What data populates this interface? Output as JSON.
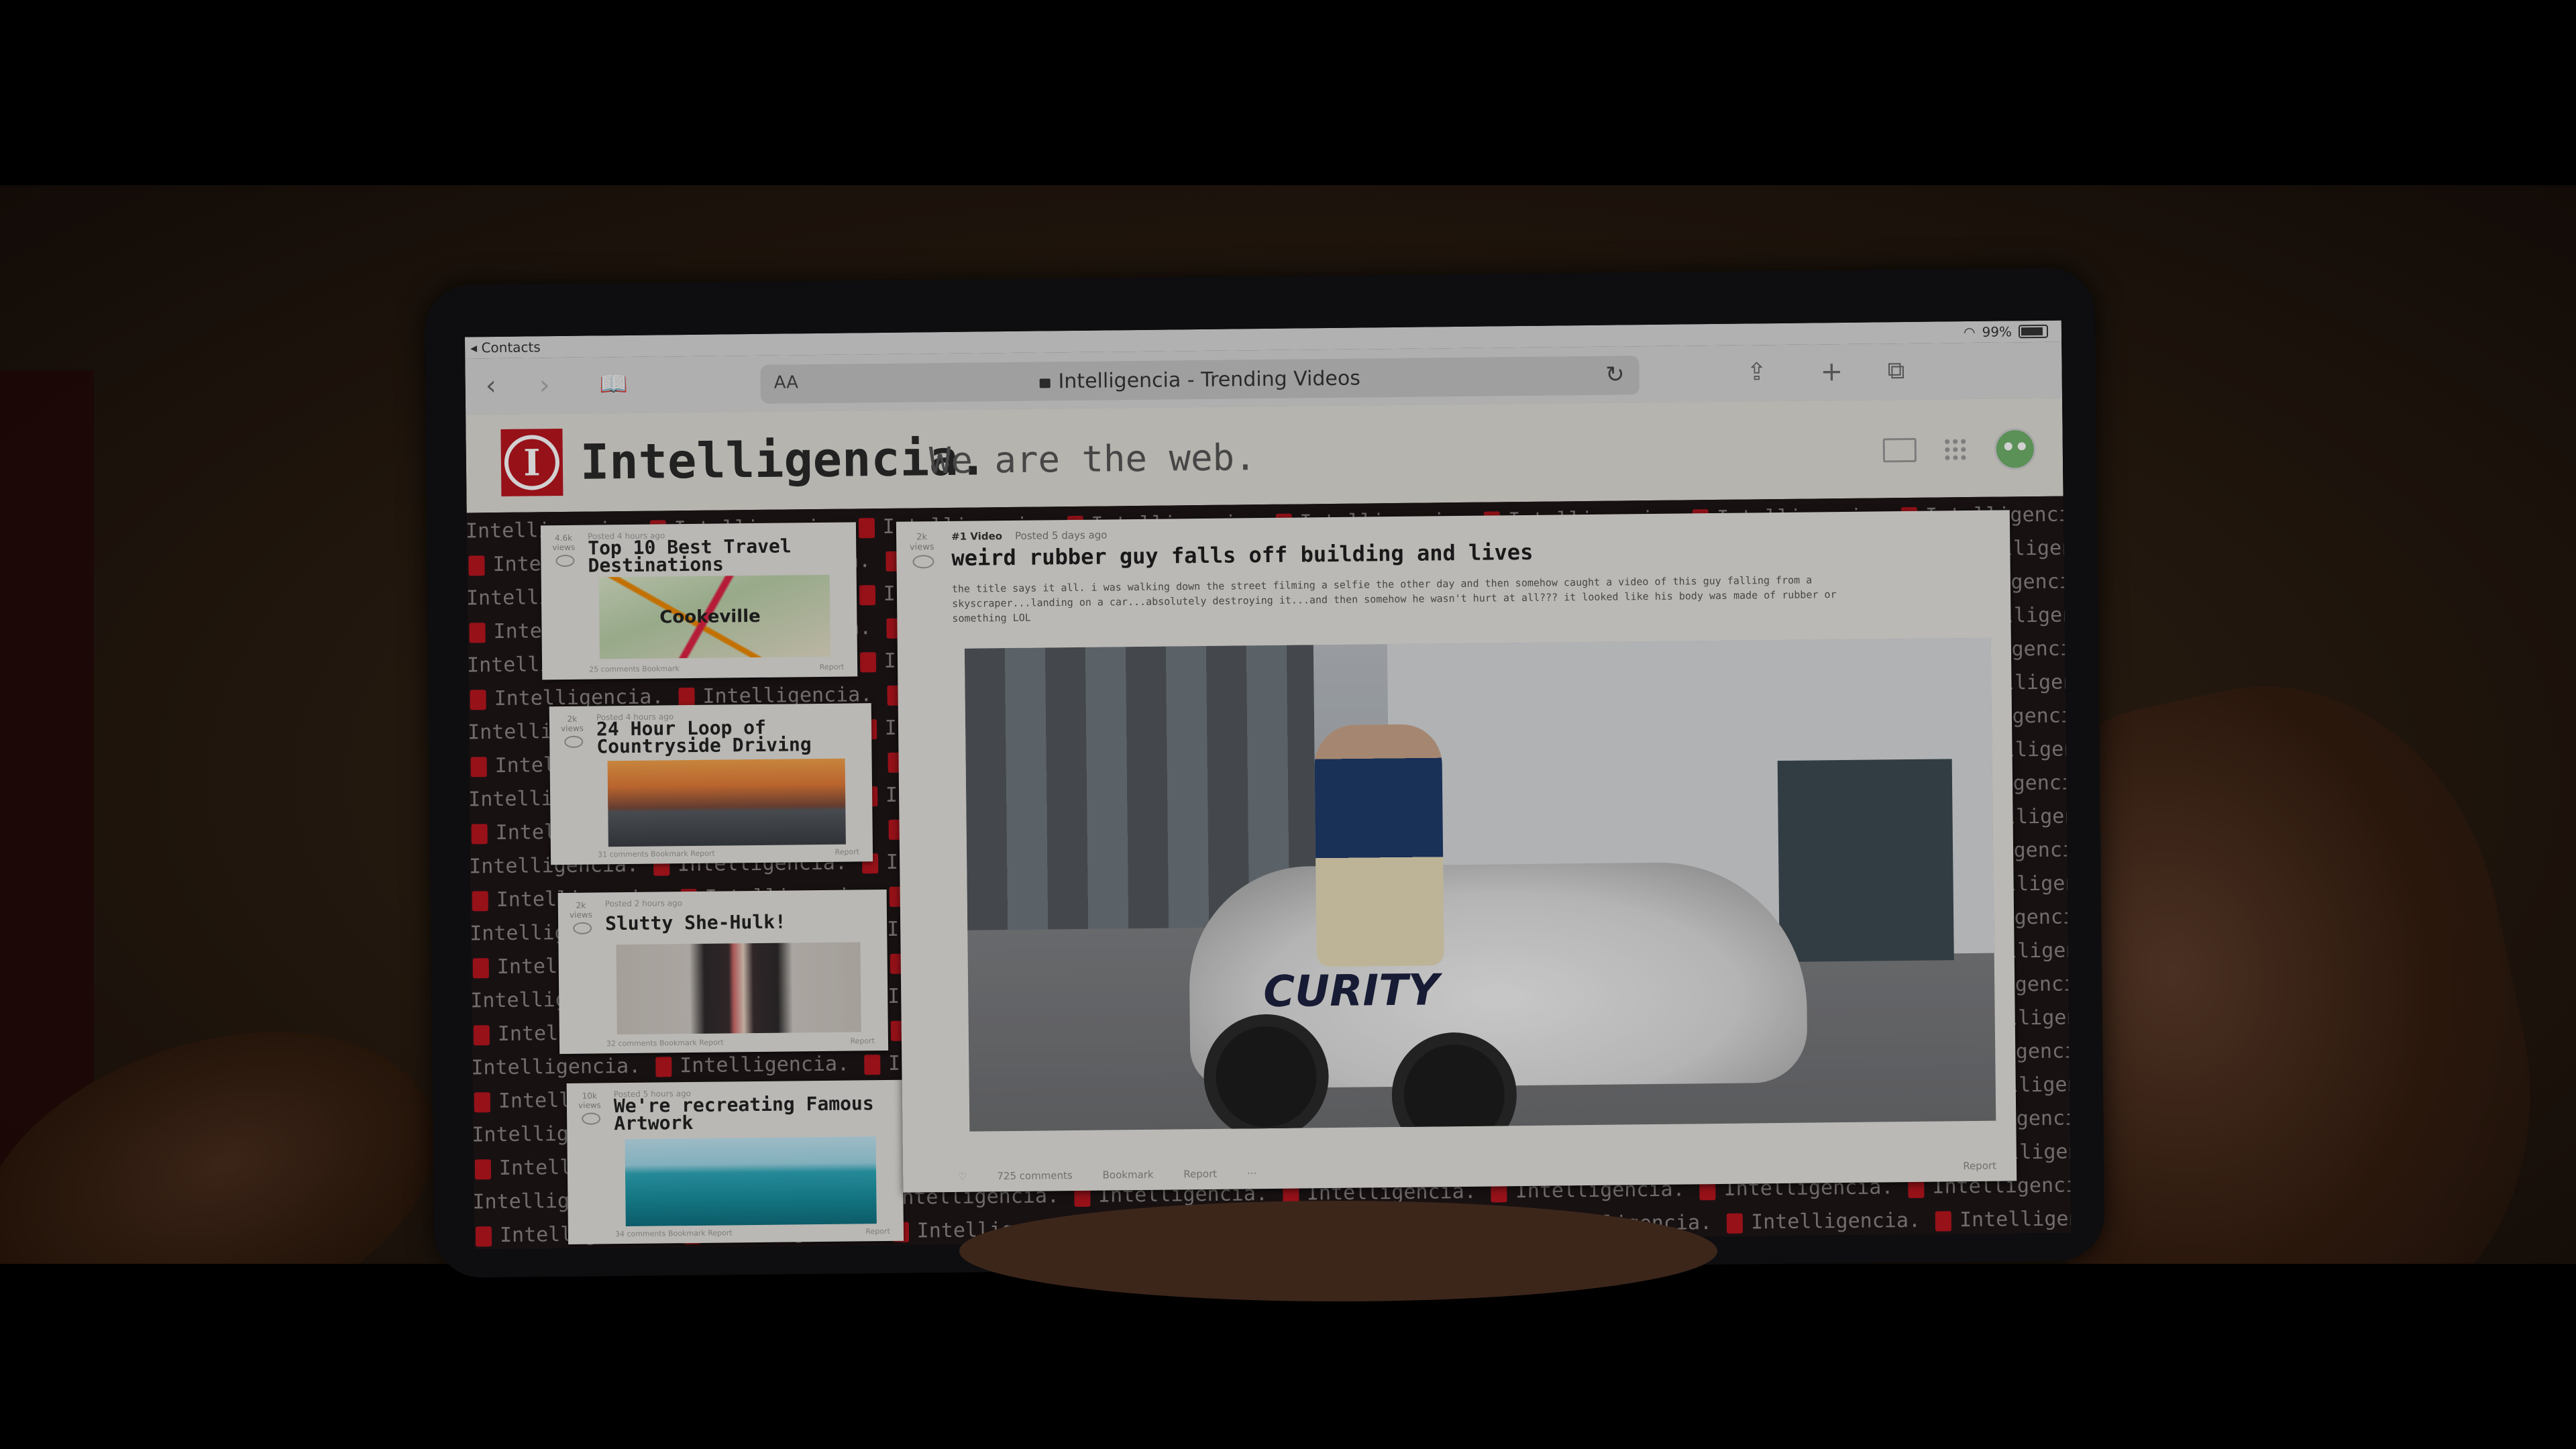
{
  "status_bar": {
    "back_label": "◂ Contacts",
    "battery": "99%"
  },
  "toolbar": {
    "aa_label": "AA",
    "url": "Intelligencia - Trending Videos"
  },
  "site": {
    "logo_letter": "I",
    "brand": "Intelligencia.",
    "tagline": "We are the web."
  },
  "pattern": {
    "word": "Intelligencia."
  },
  "sidebar": {
    "cards": [
      {
        "views": "4.6k views",
        "meta": "Posted 4 hours ago",
        "title": "Top 10 Best Travel Destinations",
        "thumb_label": "Cookeville",
        "foot": "25 comments  Bookmark",
        "report": "Report"
      },
      {
        "views": "2k views",
        "meta": "Posted 4 hours ago",
        "title": "24 Hour Loop of Countryside Driving",
        "foot": "31 comments  Bookmark  Report",
        "report": "Report"
      },
      {
        "views": "2k views",
        "meta": "Posted 2 hours ago",
        "title": "Slutty She-Hulk!",
        "foot": "32 comments  Bookmark  Report",
        "report": "Report"
      },
      {
        "views": "10k views",
        "meta": "Posted 5 hours ago",
        "title": "We're recreating Famous Artwork",
        "foot": "34 comments  Bookmark  Report",
        "report": "Report"
      }
    ]
  },
  "post": {
    "views": "2k views",
    "rank": "#1 Video",
    "meta": "Posted 5 days ago",
    "title": "weird rubber guy falls off building and lives",
    "body": "the title says it all. i was walking down the street filming a selfie the other day and then somehow caught a video of this guy falling from a skyscraper...landing on a car...absolutely destroying it...and then somehow he wasn't hurt at all??? it looked like his body was made of rubber or something LOL",
    "photo_text": "CURITY",
    "comments": "725 comments",
    "bookmark": "Bookmark",
    "report_inline": "Report",
    "more": "···",
    "report": "Report"
  }
}
